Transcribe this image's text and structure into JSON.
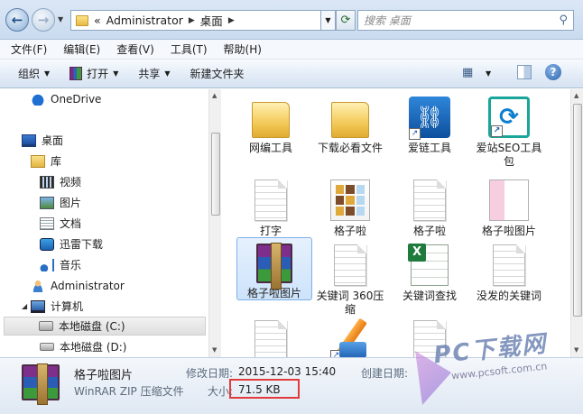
{
  "address": {
    "prefix": "«",
    "crumbs": [
      "Administrator",
      "桌面"
    ],
    "search_placeholder": "搜索 桌面"
  },
  "menu": [
    "文件(F)",
    "编辑(E)",
    "查看(V)",
    "工具(T)",
    "帮助(H)"
  ],
  "toolbar": {
    "organize": "组织",
    "open": "打开",
    "share": "共享",
    "new_folder": "新建文件夹"
  },
  "nav": {
    "onedrive": "OneDrive",
    "desktop": "桌面",
    "library": "库",
    "video": "视频",
    "pictures": "图片",
    "documents": "文档",
    "xunlei": "迅雷下载",
    "music": "音乐",
    "admin": "Administrator",
    "computer": "计算机",
    "drive_c": "本地磁盘 (C:)",
    "drive_d": "本地磁盘 (D:)"
  },
  "files": [
    {
      "label": "网编工具"
    },
    {
      "label": "下载必看文件"
    },
    {
      "label": "爱链工具"
    },
    {
      "label": "爱站SEO工具包"
    },
    {
      "label": "打字"
    },
    {
      "label": "格子啦"
    },
    {
      "label": "格子啦"
    },
    {
      "label": "格子啦图片"
    },
    {
      "label": "格子啦图片"
    },
    {
      "label": "关键词 360压缩"
    },
    {
      "label": "关键词查找"
    },
    {
      "label": "没发的关键词"
    }
  ],
  "details": {
    "name": "格子啦图片",
    "type": "WinRAR ZIP 压缩文件",
    "modified_key": "修改日期:",
    "modified_val": "2015-12-03 15:40",
    "created_key": "创建日期:",
    "size_key": "大小:",
    "size_val": "71.5 KB"
  },
  "watermark": {
    "brand": "PC下载网",
    "url": "www.pcsoft.com.cn"
  }
}
